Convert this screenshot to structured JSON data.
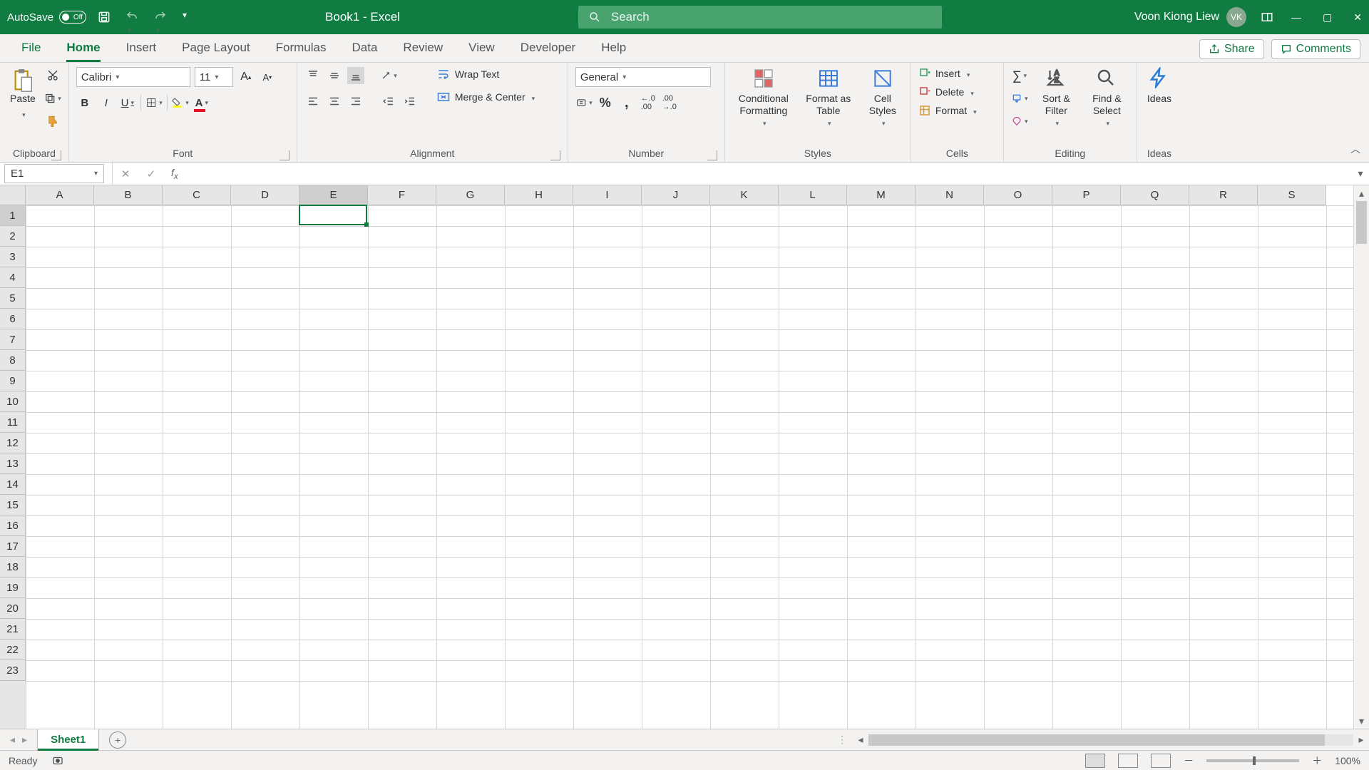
{
  "titlebar": {
    "autosave_label": "AutoSave",
    "autosave_state": "Off",
    "document_title": "Book1  -  Excel",
    "search_placeholder": "Search",
    "user_name": "Voon Kiong Liew",
    "user_initials": "VK"
  },
  "tabs": {
    "file": "File",
    "list": [
      "Home",
      "Insert",
      "Page Layout",
      "Formulas",
      "Data",
      "Review",
      "View",
      "Developer",
      "Help"
    ],
    "active": "Home",
    "share": "Share",
    "comments": "Comments"
  },
  "ribbon": {
    "clipboard": {
      "paste": "Paste",
      "label": "Clipboard"
    },
    "font": {
      "name": "Calibri",
      "size": "11",
      "label": "Font"
    },
    "alignment": {
      "wrap": "Wrap Text",
      "merge": "Merge & Center",
      "label": "Alignment"
    },
    "number": {
      "format": "General",
      "label": "Number"
    },
    "styles": {
      "conditional": "Conditional Formatting",
      "table": "Format as Table",
      "cell": "Cell Styles",
      "label": "Styles"
    },
    "cells": {
      "insert": "Insert",
      "delete": "Delete",
      "format": "Format",
      "label": "Cells"
    },
    "editing": {
      "sort": "Sort & Filter",
      "find": "Find & Select",
      "label": "Editing"
    },
    "ideas": {
      "ideas": "Ideas",
      "label": "Ideas"
    }
  },
  "formula_bar": {
    "name_box": "E1",
    "formula": ""
  },
  "grid": {
    "columns": [
      "A",
      "B",
      "C",
      "D",
      "E",
      "F",
      "G",
      "H",
      "I",
      "J",
      "K",
      "L",
      "M",
      "N",
      "O",
      "P",
      "Q",
      "R",
      "S"
    ],
    "rows": [
      1,
      2,
      3,
      4,
      5,
      6,
      7,
      8,
      9,
      10,
      11,
      12,
      13,
      14,
      15,
      16,
      17,
      18,
      19,
      20,
      21,
      22,
      23
    ],
    "selected_cell": "E1",
    "selected_col_index": 4,
    "selected_row_index": 0
  },
  "sheets": {
    "active": "Sheet1"
  },
  "status": {
    "mode": "Ready",
    "zoom": "100%"
  }
}
